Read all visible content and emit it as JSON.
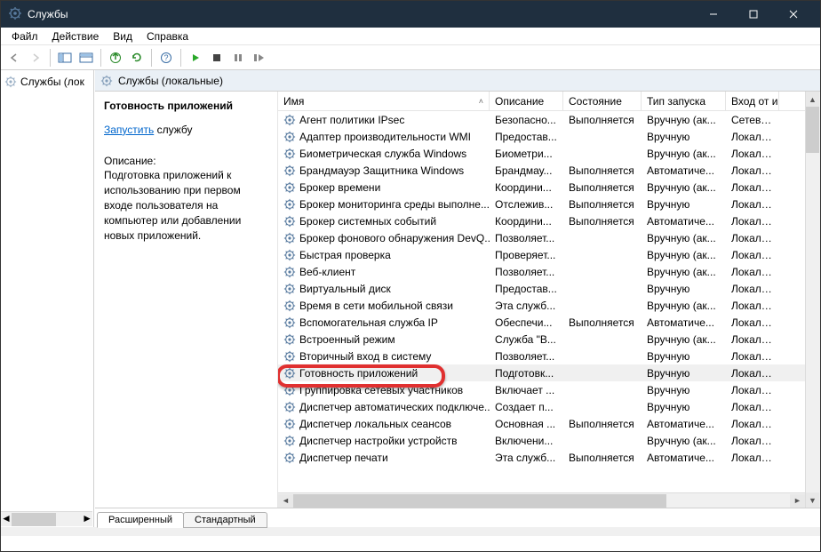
{
  "window": {
    "title": "Службы"
  },
  "menu": {
    "file": "Файл",
    "action": "Действие",
    "view": "Вид",
    "help": "Справка"
  },
  "lefttree": {
    "root": "Службы (лок"
  },
  "header": {
    "title": "Службы (локальные)"
  },
  "detail": {
    "name": "Готовность приложений",
    "start_label": "Запустить",
    "start_suffix": " службу",
    "desc_label": "Описание:",
    "desc_text": "Подготовка приложений к использованию при первом входе пользователя на компьютер или добавлении новых приложений."
  },
  "columns": {
    "name": "Имя",
    "desc": "Описание",
    "state": "Состояние",
    "start": "Тип запуска",
    "logon": "Вход от и"
  },
  "tabs": {
    "extended": "Расширенный",
    "standard": "Стандартный"
  },
  "rows": [
    {
      "name": "Агент политики IPsec",
      "desc": "Безопасно...",
      "state": "Выполняется",
      "start": "Вручную (ак...",
      "logon": "Сетевая с"
    },
    {
      "name": "Адаптер производительности WMI",
      "desc": "Предостав...",
      "state": "",
      "start": "Вручную",
      "logon": "Локальна"
    },
    {
      "name": "Биометрическая служба Windows",
      "desc": "Биометри...",
      "state": "",
      "start": "Вручную (ак...",
      "logon": "Локальна"
    },
    {
      "name": "Брандмауэр Защитника Windows",
      "desc": "Брандмау...",
      "state": "Выполняется",
      "start": "Автоматиче...",
      "logon": "Локальна"
    },
    {
      "name": "Брокер времени",
      "desc": "Координи...",
      "state": "Выполняется",
      "start": "Вручную (ак...",
      "logon": "Локальна"
    },
    {
      "name": "Брокер мониторинга среды выполне...",
      "desc": "Отслежив...",
      "state": "Выполняется",
      "start": "Вручную",
      "logon": "Локальна"
    },
    {
      "name": "Брокер системных событий",
      "desc": "Координи...",
      "state": "Выполняется",
      "start": "Автоматиче...",
      "logon": "Локальна"
    },
    {
      "name": "Брокер фонового обнаружения DevQ...",
      "desc": "Позволяет...",
      "state": "",
      "start": "Вручную (ак...",
      "logon": "Локальна"
    },
    {
      "name": "Быстрая проверка",
      "desc": "Проверяет...",
      "state": "",
      "start": "Вручную (ак...",
      "logon": "Локальна"
    },
    {
      "name": "Веб-клиент",
      "desc": "Позволяет...",
      "state": "",
      "start": "Вручную (ак...",
      "logon": "Локальна"
    },
    {
      "name": "Виртуальный диск",
      "desc": "Предостав...",
      "state": "",
      "start": "Вручную",
      "logon": "Локальна"
    },
    {
      "name": "Время в сети мобильной связи",
      "desc": "Эта служб...",
      "state": "",
      "start": "Вручную (ак...",
      "logon": "Локальна"
    },
    {
      "name": "Вспомогательная служба IP",
      "desc": "Обеспечи...",
      "state": "Выполняется",
      "start": "Автоматиче...",
      "logon": "Локальна"
    },
    {
      "name": "Встроенный режим",
      "desc": "Служба \"В...",
      "state": "",
      "start": "Вручную (ак...",
      "logon": "Локальна"
    },
    {
      "name": "Вторичный вход в систему",
      "desc": "Позволяет...",
      "state": "",
      "start": "Вручную",
      "logon": "Локальна"
    },
    {
      "name": "Готовность приложений",
      "desc": "Подготовк...",
      "state": "",
      "start": "Вручную",
      "logon": "Локальна",
      "selected": true
    },
    {
      "name": "Группировка сетевых участников",
      "desc": "Включает ...",
      "state": "",
      "start": "Вручную",
      "logon": "Локальна"
    },
    {
      "name": "Диспетчер автоматических подключе...",
      "desc": "Создает п...",
      "state": "",
      "start": "Вручную",
      "logon": "Локальна"
    },
    {
      "name": "Диспетчер локальных сеансов",
      "desc": "Основная ...",
      "state": "Выполняется",
      "start": "Автоматиче...",
      "logon": "Локальна"
    },
    {
      "name": "Диспетчер настройки устройств",
      "desc": "Включени...",
      "state": "",
      "start": "Вручную (ак...",
      "logon": "Локальна"
    },
    {
      "name": "Диспетчер печати",
      "desc": "Эта служб...",
      "state": "Выполняется",
      "start": "Автоматиче...",
      "logon": "Локальна"
    }
  ]
}
